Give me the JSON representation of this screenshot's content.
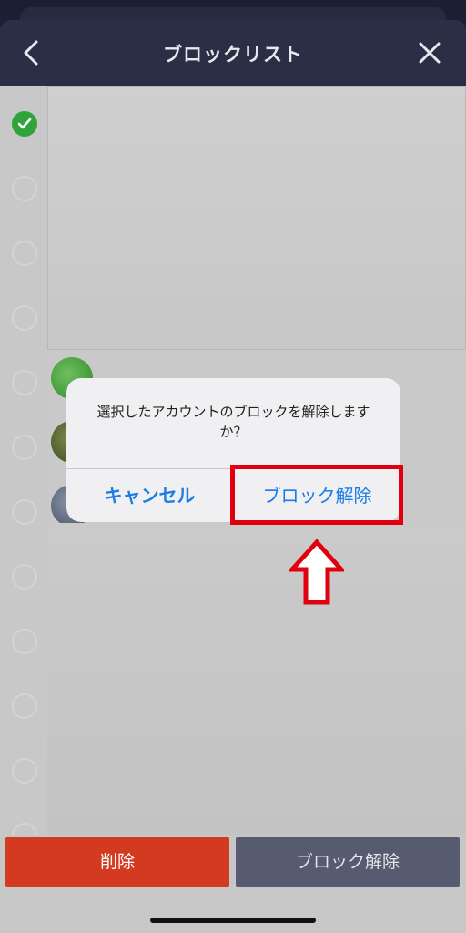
{
  "header": {
    "title": "ブロックリスト",
    "back_icon": "chevron-left-icon",
    "close_icon": "close-icon"
  },
  "list": {
    "selection_states": [
      true,
      false,
      false,
      false,
      false,
      false,
      false,
      false,
      false,
      false,
      false,
      false
    ]
  },
  "dialog": {
    "message": "選択したアカウントのブロックを解除しますか？",
    "cancel_label": "キャンセル",
    "confirm_label": "ブロック解除"
  },
  "bottom_bar": {
    "delete_label": "削除",
    "unblock_label": "ブロック解除"
  },
  "colors": {
    "header_bg": "#2a2f45",
    "check_green": "#2fa43a",
    "dialog_button_blue": "#1a7ce6",
    "annotation_red": "#e1000f",
    "delete_red": "#d43a1f",
    "unblock_gray": "#565b70"
  }
}
